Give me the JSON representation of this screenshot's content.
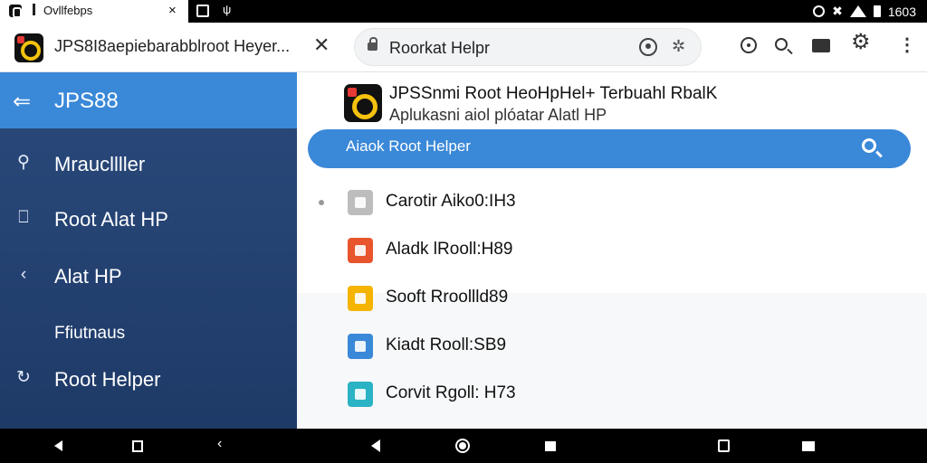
{
  "statusbar": {
    "tab_label": "Ovllfebps",
    "tab_close": "×",
    "usb": "ψ",
    "battery_text": "1603"
  },
  "appbar": {
    "title": "JPS8I8aepiebarabblroot Heyer...",
    "close": "✕",
    "url_text": "Roorkat Helpr",
    "ext_icon": "✲",
    "gear": "⚙",
    "more": "⋮"
  },
  "sidebar": {
    "back": "⇐",
    "title": "JPS88",
    "items": [
      {
        "icon": "⚲",
        "label": "Mraucllller"
      },
      {
        "icon": "⎕",
        "label": "Root Alat HP"
      },
      {
        "icon": "‹",
        "label": "Alat HP"
      },
      {
        "icon": "",
        "label": "Ffiutnaus"
      },
      {
        "icon": "↻",
        "label": "Root Helper"
      }
    ]
  },
  "content": {
    "title": "JPSSnmi Root HeoHpHel+ Terbuahl RbalK",
    "subtitle": "Aplukasni aiol plóatar Alatl HP",
    "search_text": "Aiaok Root Helper",
    "rows": [
      {
        "label": "Carotir Aiko0:IH3",
        "color": "#bdbdbd"
      },
      {
        "label": "Aladk lRooll:H89",
        "color": "#e8542b"
      },
      {
        "label": "Sooft Rroollld89",
        "color": "#f4b400"
      },
      {
        "label": "Kiadt Rooll:SB9",
        "color": "#3a88d8"
      },
      {
        "label": "Corvit Rgoll: H73",
        "color": "#2ab3c4"
      }
    ]
  }
}
